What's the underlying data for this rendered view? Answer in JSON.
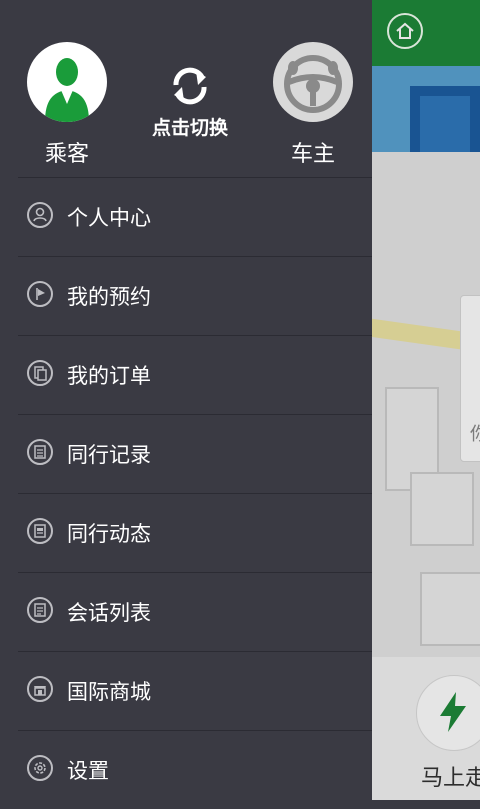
{
  "drawer": {
    "passenger_label": "乘客",
    "switch_label": "点击切换",
    "driver_label": "车主",
    "menu": [
      {
        "label": "个人中心",
        "icon": "user-icon"
      },
      {
        "label": "我的预约",
        "icon": "flag-icon"
      },
      {
        "label": "我的订单",
        "icon": "orders-icon"
      },
      {
        "label": "同行记录",
        "icon": "record-icon"
      },
      {
        "label": "同行动态",
        "icon": "news-icon"
      },
      {
        "label": "会话列表",
        "icon": "chat-list-icon"
      },
      {
        "label": "国际商城",
        "icon": "shop-icon"
      },
      {
        "label": "设置",
        "icon": "settings-icon"
      }
    ]
  },
  "background": {
    "go_button_label": "马上走",
    "locate_text": "你"
  },
  "colors": {
    "drawer_bg": "#3a3a43",
    "accent_green": "#1f8a3a",
    "passenger_avatar_green": "#1a9c3a"
  }
}
